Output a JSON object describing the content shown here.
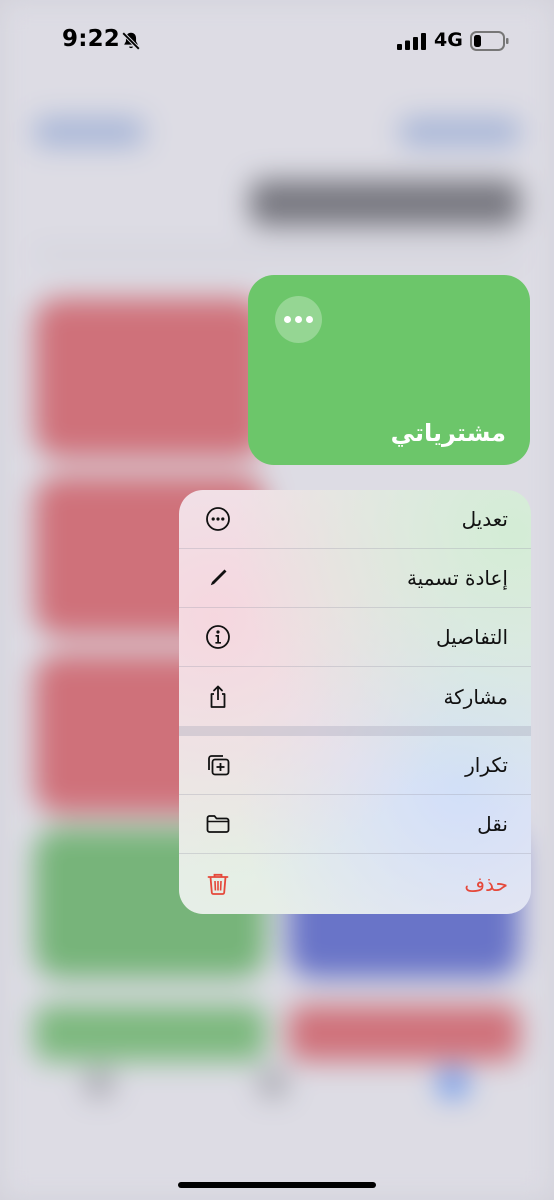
{
  "status_bar": {
    "time": "9:22",
    "network": "4G",
    "icons": [
      "bell-slash-icon",
      "cellular-signal-icon",
      "battery-icon"
    ]
  },
  "list_card": {
    "title": "مشترياتي",
    "color": "#6cc66a",
    "more_icon": "ellipsis-icon"
  },
  "context_menu": {
    "groups": [
      [
        {
          "label": "تعديل",
          "icon": "ellipsis-circle-icon"
        },
        {
          "label": "إعادة تسمية",
          "icon": "pencil-icon"
        },
        {
          "label": "التفاصيل",
          "icon": "info-circle-icon"
        },
        {
          "label": "مشاركة",
          "icon": "share-icon"
        }
      ],
      [
        {
          "label": "تكرار",
          "icon": "duplicate-icon"
        },
        {
          "label": "نقل",
          "icon": "folder-icon"
        },
        {
          "label": "حذف",
          "icon": "trash-icon",
          "destructive": true
        }
      ]
    ],
    "destructive_color": "#e5483a"
  }
}
